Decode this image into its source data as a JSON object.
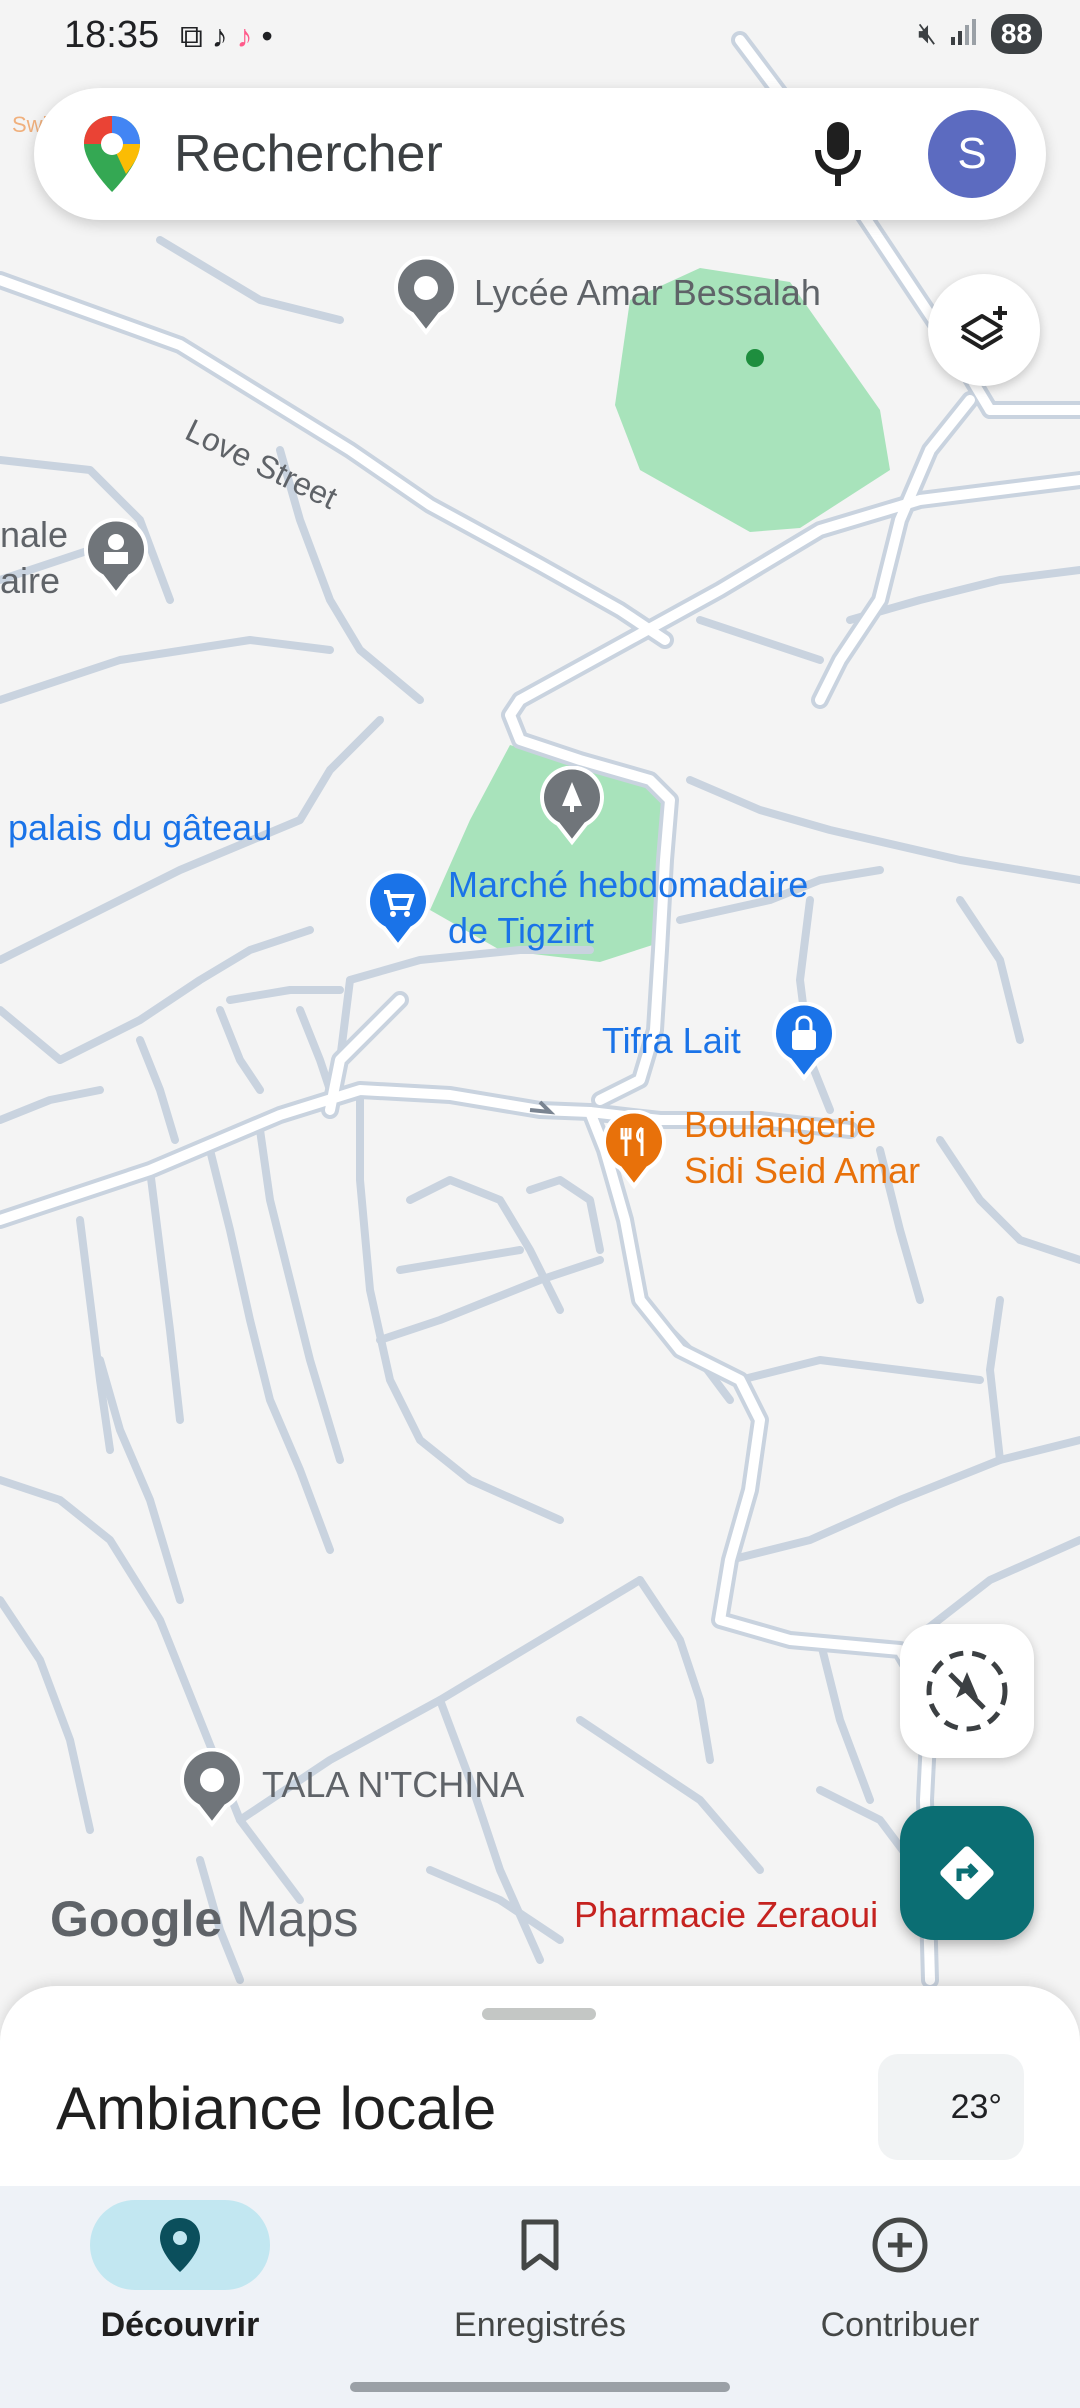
{
  "status_bar": {
    "time": "18:35",
    "battery": "88",
    "watermark": "Swiga"
  },
  "search": {
    "placeholder": "Rechercher",
    "avatar_letter": "S"
  },
  "map": {
    "labels": {
      "lycee": "Lycée Amar Bessalah",
      "love_street": "Love Street",
      "cut_left_1": "nale",
      "cut_left_2": "aire",
      "palais": "palais du gâteau",
      "marche_1": "Marché hebdomadaire",
      "marche_2": "de Tigzirt",
      "tifra": "Tifra Lait",
      "boulangerie_1": "Boulangerie",
      "boulangerie_2": "Sidi Seid Amar",
      "tala": "TALA N'TCHINA",
      "pharmacie": "Pharmacie Zeraoui"
    },
    "colors": {
      "road_outline": "#c9d3df",
      "road_fill": "#ffffff",
      "park": "#a8e3bb",
      "blue_poi": "#1a73e8",
      "orange_poi": "#e8710a",
      "red_poi": "#d93025",
      "gray_poi": "#70757a"
    },
    "icons": [
      "layers-icon",
      "compass-icon",
      "directions-icon",
      "microphone-icon"
    ]
  },
  "logo": {
    "google": "Google",
    "maps": "Maps"
  },
  "sheet": {
    "title": "Ambiance locale",
    "temperature": "23°"
  },
  "nav": {
    "items": [
      {
        "label": "Découvrir",
        "icon": "place-icon",
        "active": true
      },
      {
        "label": "Enregistrés",
        "icon": "bookmark-icon",
        "active": false
      },
      {
        "label": "Contribuer",
        "icon": "add-circle-icon",
        "active": false
      }
    ]
  }
}
